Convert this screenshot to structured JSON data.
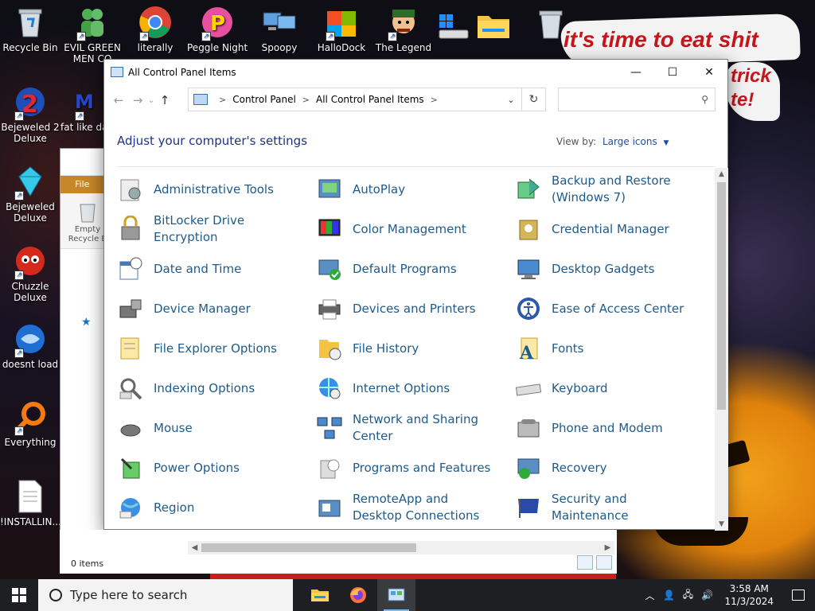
{
  "desktop": {
    "icons": [
      {
        "label": "Recycle Bin"
      },
      {
        "label": "EVIL GREEN MEN CO"
      },
      {
        "label": "literally"
      },
      {
        "label": "Peggle Nights"
      },
      {
        "label": "Spoopy"
      },
      {
        "label": "HalloDock"
      },
      {
        "label": "The Legend"
      },
      {
        "label": "Bejeweled 2 Deluxe"
      },
      {
        "label": "fat like da"
      },
      {
        "label": "Bejeweled Deluxe"
      },
      {
        "label": "Chuzzle Deluxe"
      },
      {
        "label": "doesnt load"
      },
      {
        "label": "Everything"
      },
      {
        "label": "!INSTALLIN..."
      }
    ],
    "wallpaper_text": {
      "line1": "it's time to eat shit",
      "line2": "trick",
      "line3": "te!"
    }
  },
  "background_window": {
    "ribbon_file": "File",
    "empty_recycle": "Empty Recycle B",
    "status": "0 items"
  },
  "window": {
    "title": "All Control Panel Items",
    "minimize": "—",
    "maximize": "☐",
    "close": "✕",
    "back": "←",
    "forward": "→",
    "up": "↑",
    "breadcrumb": [
      "Control Panel",
      "All Control Panel Items"
    ],
    "search_placeholder": "",
    "heading": "Adjust your computer's settings",
    "view_by_label": "View by:",
    "view_by_value": "Large icons"
  },
  "items": [
    {
      "label": "Administrative Tools",
      "icon": "admin-tools"
    },
    {
      "label": "AutoPlay",
      "icon": "autoplay"
    },
    {
      "label": "Backup and Restore (Windows 7)",
      "icon": "backup"
    },
    {
      "label": "BitLocker Drive Encryption",
      "icon": "bitlocker"
    },
    {
      "label": "Color Management",
      "icon": "color-mgmt"
    },
    {
      "label": "Credential Manager",
      "icon": "credential"
    },
    {
      "label": "Date and Time",
      "icon": "datetime"
    },
    {
      "label": "Default Programs",
      "icon": "default-programs"
    },
    {
      "label": "Desktop Gadgets",
      "icon": "gadgets"
    },
    {
      "label": "Device Manager",
      "icon": "device-manager"
    },
    {
      "label": "Devices and Printers",
      "icon": "printers"
    },
    {
      "label": "Ease of Access Center",
      "icon": "ease-of-access"
    },
    {
      "label": "File Explorer Options",
      "icon": "folder-options"
    },
    {
      "label": "File History",
      "icon": "file-history"
    },
    {
      "label": "Fonts",
      "icon": "fonts"
    },
    {
      "label": "Indexing Options",
      "icon": "indexing"
    },
    {
      "label": "Internet Options",
      "icon": "internet"
    },
    {
      "label": "Keyboard",
      "icon": "keyboard"
    },
    {
      "label": "Mouse",
      "icon": "mouse"
    },
    {
      "label": "Network and Sharing Center",
      "icon": "network"
    },
    {
      "label": "Phone and Modem",
      "icon": "phone"
    },
    {
      "label": "Power Options",
      "icon": "power"
    },
    {
      "label": "Programs and Features",
      "icon": "programs"
    },
    {
      "label": "Recovery",
      "icon": "recovery"
    },
    {
      "label": "Region",
      "icon": "region"
    },
    {
      "label": "RemoteApp and Desktop Connections",
      "icon": "remoteapp"
    },
    {
      "label": "Security and Maintenance",
      "icon": "security"
    }
  ],
  "taskbar": {
    "search_placeholder": "Type here to search",
    "time": "3:58 AM",
    "date": "11/3/2024"
  },
  "colors": {
    "link": "#1e5b8c",
    "heading": "#1e3287",
    "taskbar": "#1e1f22",
    "accent": "#76b9ed"
  }
}
